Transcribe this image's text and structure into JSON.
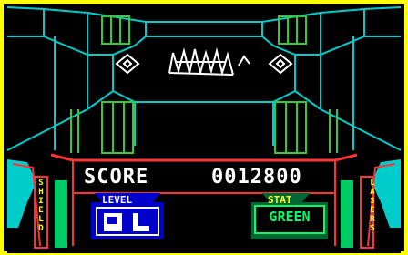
{
  "hud": {
    "score_label": "SCORE",
    "score_value": "0012800",
    "level_label": "LEVEL",
    "stat_label": "STAT",
    "stat_value": "GREEN",
    "shield_label": "SHIELD",
    "lasers_label": "LASERS"
  },
  "gauges": {
    "shield_level": 1.0,
    "lasers_level": 1.0
  },
  "icons": {
    "enemy": "wireframe-spiky-creature-icon",
    "left_drone": "diamond-drone-icon",
    "right_drone": "diamond-drone-icon",
    "level_indicator": "level-block-icons"
  },
  "colors": {
    "border": "#ffff00",
    "wireframe": "#00cccc",
    "pillars": "#33cc33",
    "hud_frame": "#ff3333",
    "hud_accent": "#00cccc",
    "text": "#ffffff",
    "panel_blue": "#0000cc",
    "gauge_green": "#00cc66"
  }
}
